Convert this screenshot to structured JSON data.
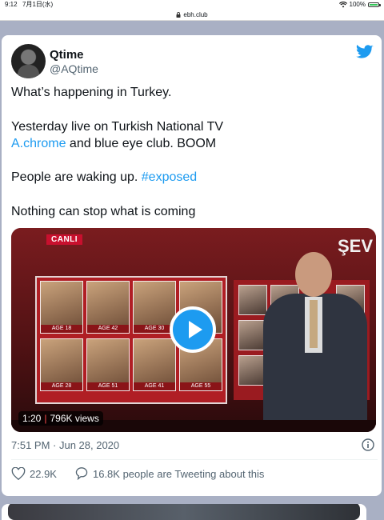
{
  "status_bar": {
    "time": "9:12",
    "date": "7月1日(水)",
    "battery": "100%",
    "battery_level": 1.0,
    "icons": [
      "wifi-icon",
      "battery-icon"
    ]
  },
  "url_bar": {
    "domain": "ebh.club",
    "icon": "lock-icon"
  },
  "tweet": {
    "author": {
      "name": "Qtime",
      "handle": "@AQtime"
    },
    "lines": {
      "l1": "What’s happening in Turkey.",
      "l2": "Yesterday live on Turkish National TV",
      "l3_link": "A.chrome",
      "l3_rest": " and blue eye club. BOOM",
      "l4_text": "People are waking up. ",
      "l4_hashtag": "#exposed",
      "l5": "Nothing can stop what is coming"
    },
    "media": {
      "overlay_canli": "CANLI",
      "overlay_sev": "ŞEV",
      "age_labels": [
        "AGE 18",
        "AGE 42",
        "AGE 30",
        "",
        "AGE 28",
        "AGE 51",
        "AGE 41",
        "AGE 55"
      ],
      "duration": "1:20",
      "views": "796K views"
    },
    "timestamp": "7:51 PM · Jun 28, 2020",
    "likes": "22.9K",
    "tweeting_about": "16.8K people are Tweeting about this"
  },
  "colors": {
    "link": "#1d9bf0",
    "page_bg": "#a9b0c4",
    "text": "#0f1419",
    "muted": "#536471"
  }
}
